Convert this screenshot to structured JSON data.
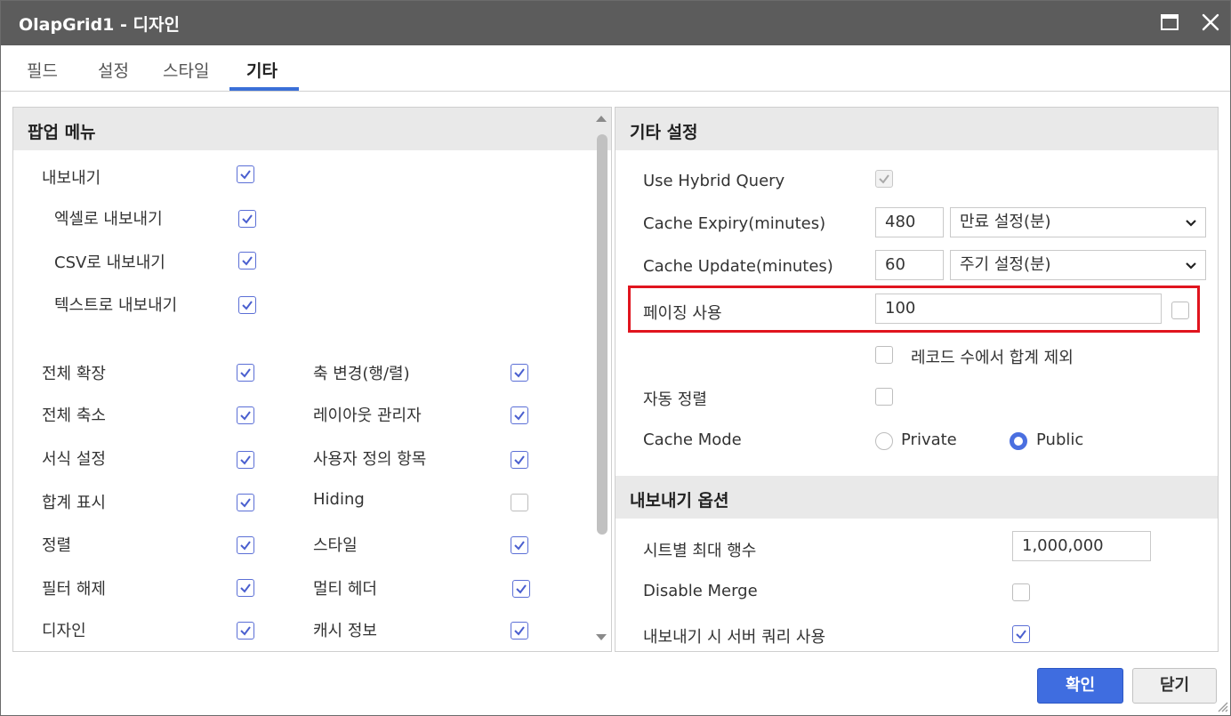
{
  "window": {
    "title": "OlapGrid1 - 디자인"
  },
  "tabs": [
    {
      "label": "필드"
    },
    {
      "label": "설정"
    },
    {
      "label": "스타일"
    },
    {
      "label": "기타",
      "active": true
    }
  ],
  "popup_menu": {
    "header": "팝업 메뉴",
    "export": {
      "label": "내보내기",
      "checked": true
    },
    "export_excel": {
      "label": "엑셀로 내보내기",
      "checked": true
    },
    "export_csv": {
      "label": "CSV로 내보내기",
      "checked": true
    },
    "export_text": {
      "label": "텍스트로 내보내기",
      "checked": true
    },
    "left_items": [
      {
        "label": "전체 확장",
        "checked": true
      },
      {
        "label": "전체 축소",
        "checked": true
      },
      {
        "label": "서식 설정",
        "checked": true
      },
      {
        "label": "합계 표시",
        "checked": true
      },
      {
        "label": "정렬",
        "checked": true
      },
      {
        "label": "필터 해제",
        "checked": true
      },
      {
        "label": "디자인",
        "checked": true
      }
    ],
    "right_items": [
      {
        "label": "축 변경(행/렬)",
        "checked": true
      },
      {
        "label": "레이아웃 관리자",
        "checked": true
      },
      {
        "label": "사용자 정의 항목",
        "checked": true
      },
      {
        "label": "Hiding",
        "checked": false
      },
      {
        "label": "스타일",
        "checked": true
      },
      {
        "label": "멀티 헤더",
        "checked": true
      },
      {
        "label": "캐시 정보",
        "checked": true
      }
    ]
  },
  "other_settings": {
    "header": "기타 설정",
    "hybrid_query": {
      "label": "Use Hybrid Query",
      "checked": true,
      "disabled": true
    },
    "cache_expiry": {
      "label": "Cache Expiry(minutes)",
      "value": "480",
      "select": "만료 설정(분)"
    },
    "cache_update": {
      "label": "Cache Update(minutes)",
      "value": "60",
      "select": "주기 설정(분)"
    },
    "paging": {
      "label": "페이징 사용",
      "value": "100",
      "checked": false
    },
    "exclude_total": {
      "label": "레코드 수에서 합계 제외",
      "checked": false
    },
    "auto_sort": {
      "label": "자동 정렬",
      "checked": false
    },
    "cache_mode": {
      "label": "Cache Mode",
      "options": [
        "Private",
        "Public"
      ],
      "selected": "Public"
    }
  },
  "export_options": {
    "header": "내보내기 옵션",
    "max_rows": {
      "label": "시트별 최대 행수",
      "value": "1,000,000"
    },
    "disable_merge": {
      "label": "Disable Merge",
      "checked": false
    },
    "server_query": {
      "label": "내보내기 시 서버 쿼리 사용",
      "checked": true
    }
  },
  "buttons": {
    "ok": "확인",
    "close": "닫기"
  },
  "colors": {
    "accent": "#3f6de0",
    "titlebar": "#5c5c5c",
    "highlight": "#e0141e"
  }
}
